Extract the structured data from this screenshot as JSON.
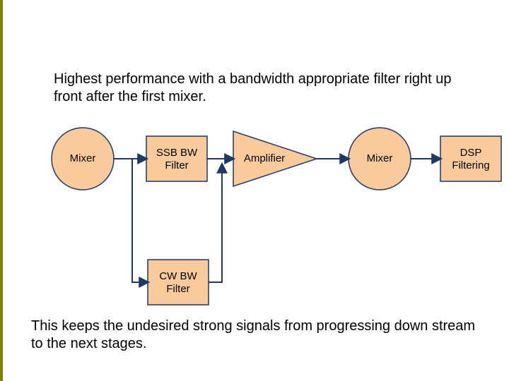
{
  "intro": "Highest performance with a bandwidth appropriate filter right up front after the first mixer.",
  "footer": "This keeps the undesired strong signals from progressing down stream to the next stages.",
  "blocks": {
    "mixer1": "Mixer",
    "ssb_filter_l1": "SSB BW",
    "ssb_filter_l2": "Filter",
    "amplifier": "Amplifier",
    "mixer2": "Mixer",
    "dsp_l1": "DSP",
    "dsp_l2": "Filtering",
    "cw_filter_l1": "CW BW",
    "cw_filter_l2": "Filter"
  },
  "colors": {
    "fill": "#f9cb9c",
    "stroke": "#1f3864",
    "line": "#1f3864"
  }
}
